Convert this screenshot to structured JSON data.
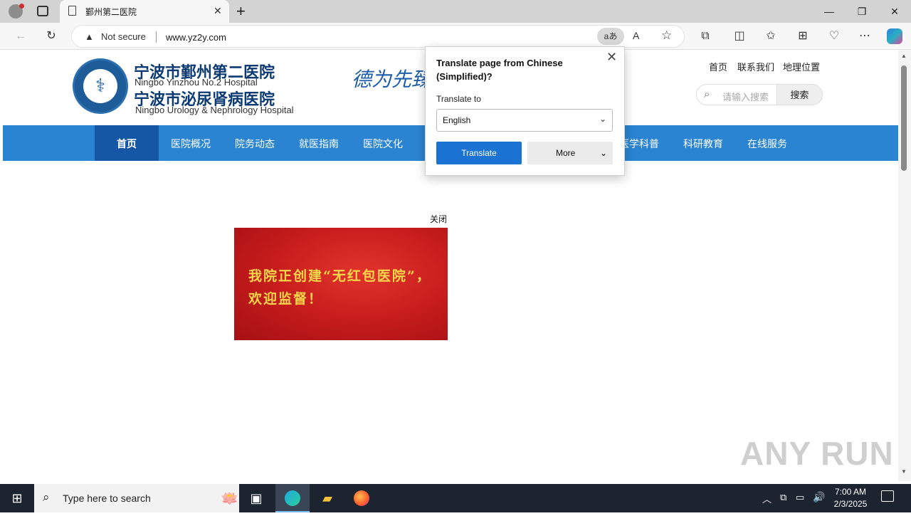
{
  "browser": {
    "tab_title": "鄞州第二医院",
    "security_label": "Not secure",
    "url": "www.yz2y.com",
    "new_tab_symbol": "+"
  },
  "site": {
    "name_cn_1": "宁波市鄞州第二医院",
    "name_en_1": "Ningbo Yinzhou No.2 Hospital",
    "name_cn_2": "宁波市泌尿肾病医院",
    "name_en_2": "Ningbo Urology & Nephrology Hospital",
    "slogan": "德为先臻",
    "top_links": [
      "首页",
      "联系我们",
      "地理位置"
    ],
    "search_placeholder": "请输入搜索",
    "search_button": "搜索",
    "nav": [
      "首页",
      "医院概况",
      "院务动态",
      "就医指南",
      "医院文化",
      "医学科普",
      "科研教育",
      "在线服务"
    ],
    "popup_close": "关闭",
    "banner_text": "我院正创建“无红包医院”，欢迎监督！"
  },
  "translate_popup": {
    "title": "Translate page from Chinese (Simplified)?",
    "label": "Translate to",
    "selected_language": "English",
    "translate_button": "Translate",
    "more_button": "More"
  },
  "watermark": "ANY RUN",
  "taskbar": {
    "search_placeholder": "Type here to search",
    "time": "7:00 AM",
    "date": "2/3/2025"
  },
  "colors": {
    "nav_bg": "#2a84d1",
    "nav_active": "#1557a4",
    "translate_button": "#1a73d2"
  }
}
